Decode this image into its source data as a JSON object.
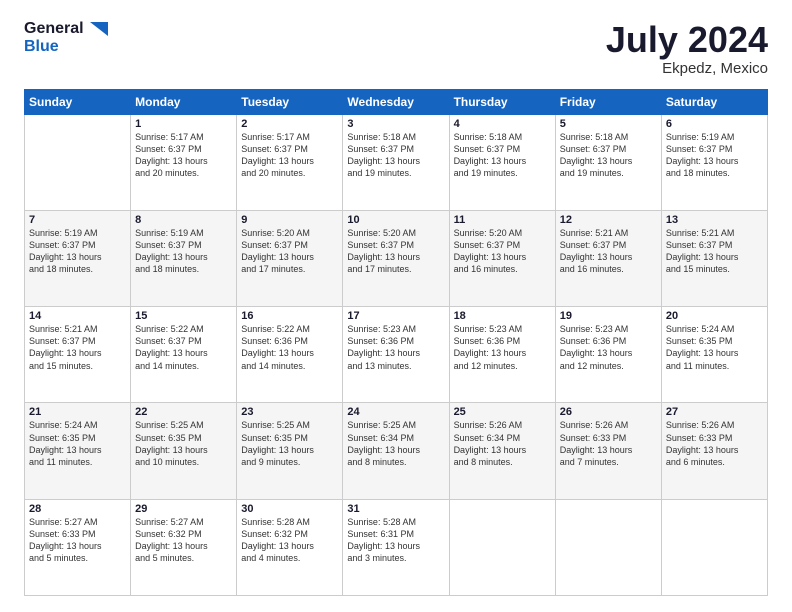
{
  "logo": {
    "line1": "General",
    "line2": "Blue"
  },
  "title": "July 2024",
  "subtitle": "Ekpedz, Mexico",
  "days_header": [
    "Sunday",
    "Monday",
    "Tuesday",
    "Wednesday",
    "Thursday",
    "Friday",
    "Saturday"
  ],
  "weeks": [
    [
      {
        "num": "",
        "text": ""
      },
      {
        "num": "1",
        "text": "Sunrise: 5:17 AM\nSunset: 6:37 PM\nDaylight: 13 hours\nand 20 minutes."
      },
      {
        "num": "2",
        "text": "Sunrise: 5:17 AM\nSunset: 6:37 PM\nDaylight: 13 hours\nand 20 minutes."
      },
      {
        "num": "3",
        "text": "Sunrise: 5:18 AM\nSunset: 6:37 PM\nDaylight: 13 hours\nand 19 minutes."
      },
      {
        "num": "4",
        "text": "Sunrise: 5:18 AM\nSunset: 6:37 PM\nDaylight: 13 hours\nand 19 minutes."
      },
      {
        "num": "5",
        "text": "Sunrise: 5:18 AM\nSunset: 6:37 PM\nDaylight: 13 hours\nand 19 minutes."
      },
      {
        "num": "6",
        "text": "Sunrise: 5:19 AM\nSunset: 6:37 PM\nDaylight: 13 hours\nand 18 minutes."
      }
    ],
    [
      {
        "num": "7",
        "text": "Sunrise: 5:19 AM\nSunset: 6:37 PM\nDaylight: 13 hours\nand 18 minutes."
      },
      {
        "num": "8",
        "text": "Sunrise: 5:19 AM\nSunset: 6:37 PM\nDaylight: 13 hours\nand 18 minutes."
      },
      {
        "num": "9",
        "text": "Sunrise: 5:20 AM\nSunset: 6:37 PM\nDaylight: 13 hours\nand 17 minutes."
      },
      {
        "num": "10",
        "text": "Sunrise: 5:20 AM\nSunset: 6:37 PM\nDaylight: 13 hours\nand 17 minutes."
      },
      {
        "num": "11",
        "text": "Sunrise: 5:20 AM\nSunset: 6:37 PM\nDaylight: 13 hours\nand 16 minutes."
      },
      {
        "num": "12",
        "text": "Sunrise: 5:21 AM\nSunset: 6:37 PM\nDaylight: 13 hours\nand 16 minutes."
      },
      {
        "num": "13",
        "text": "Sunrise: 5:21 AM\nSunset: 6:37 PM\nDaylight: 13 hours\nand 15 minutes."
      }
    ],
    [
      {
        "num": "14",
        "text": "Sunrise: 5:21 AM\nSunset: 6:37 PM\nDaylight: 13 hours\nand 15 minutes."
      },
      {
        "num": "15",
        "text": "Sunrise: 5:22 AM\nSunset: 6:37 PM\nDaylight: 13 hours\nand 14 minutes."
      },
      {
        "num": "16",
        "text": "Sunrise: 5:22 AM\nSunset: 6:36 PM\nDaylight: 13 hours\nand 14 minutes."
      },
      {
        "num": "17",
        "text": "Sunrise: 5:23 AM\nSunset: 6:36 PM\nDaylight: 13 hours\nand 13 minutes."
      },
      {
        "num": "18",
        "text": "Sunrise: 5:23 AM\nSunset: 6:36 PM\nDaylight: 13 hours\nand 12 minutes."
      },
      {
        "num": "19",
        "text": "Sunrise: 5:23 AM\nSunset: 6:36 PM\nDaylight: 13 hours\nand 12 minutes."
      },
      {
        "num": "20",
        "text": "Sunrise: 5:24 AM\nSunset: 6:35 PM\nDaylight: 13 hours\nand 11 minutes."
      }
    ],
    [
      {
        "num": "21",
        "text": "Sunrise: 5:24 AM\nSunset: 6:35 PM\nDaylight: 13 hours\nand 11 minutes."
      },
      {
        "num": "22",
        "text": "Sunrise: 5:25 AM\nSunset: 6:35 PM\nDaylight: 13 hours\nand 10 minutes."
      },
      {
        "num": "23",
        "text": "Sunrise: 5:25 AM\nSunset: 6:35 PM\nDaylight: 13 hours\nand 9 minutes."
      },
      {
        "num": "24",
        "text": "Sunrise: 5:25 AM\nSunset: 6:34 PM\nDaylight: 13 hours\nand 8 minutes."
      },
      {
        "num": "25",
        "text": "Sunrise: 5:26 AM\nSunset: 6:34 PM\nDaylight: 13 hours\nand 8 minutes."
      },
      {
        "num": "26",
        "text": "Sunrise: 5:26 AM\nSunset: 6:33 PM\nDaylight: 13 hours\nand 7 minutes."
      },
      {
        "num": "27",
        "text": "Sunrise: 5:26 AM\nSunset: 6:33 PM\nDaylight: 13 hours\nand 6 minutes."
      }
    ],
    [
      {
        "num": "28",
        "text": "Sunrise: 5:27 AM\nSunset: 6:33 PM\nDaylight: 13 hours\nand 5 minutes."
      },
      {
        "num": "29",
        "text": "Sunrise: 5:27 AM\nSunset: 6:32 PM\nDaylight: 13 hours\nand 5 minutes."
      },
      {
        "num": "30",
        "text": "Sunrise: 5:28 AM\nSunset: 6:32 PM\nDaylight: 13 hours\nand 4 minutes."
      },
      {
        "num": "31",
        "text": "Sunrise: 5:28 AM\nSunset: 6:31 PM\nDaylight: 13 hours\nand 3 minutes."
      },
      {
        "num": "",
        "text": ""
      },
      {
        "num": "",
        "text": ""
      },
      {
        "num": "",
        "text": ""
      }
    ]
  ]
}
